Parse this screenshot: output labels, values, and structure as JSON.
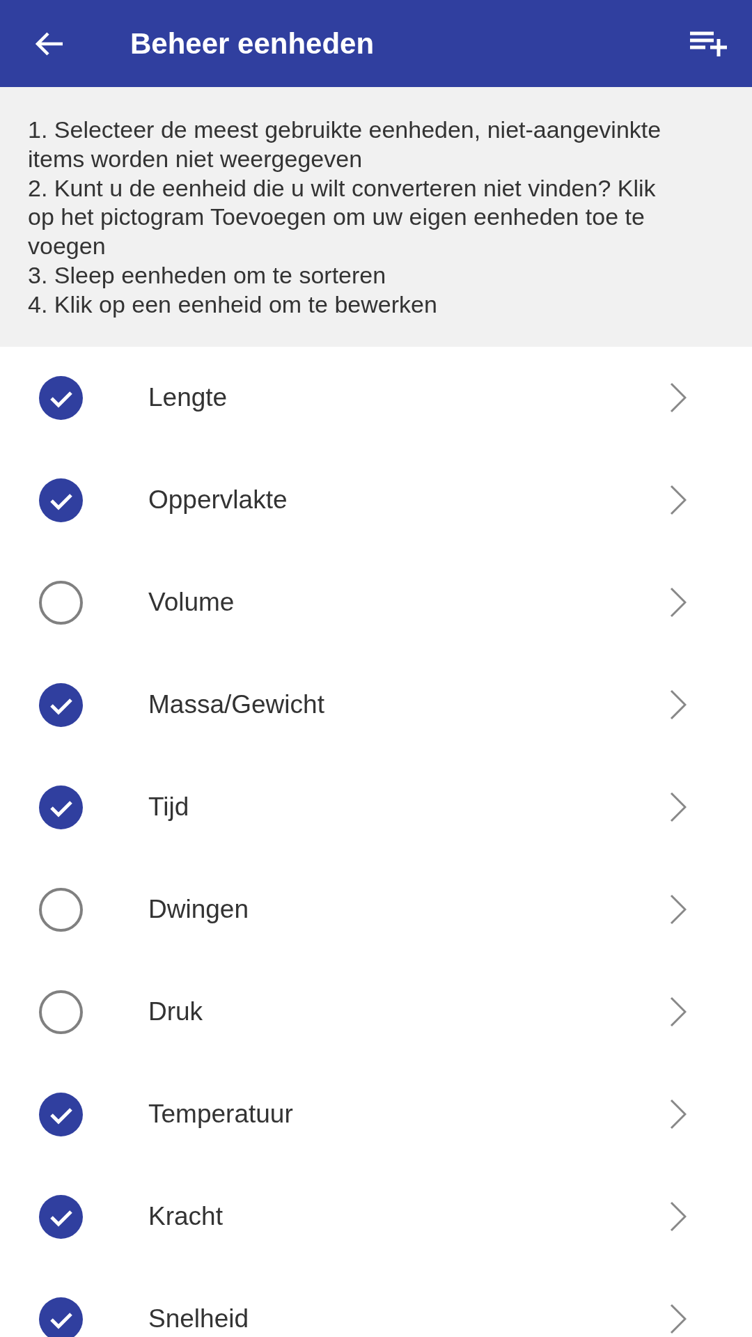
{
  "app_bar": {
    "title": "Beheer eenheden"
  },
  "instructions": [
    "1. Selecteer de meest gebruikte eenheden, niet-aangevinkte items worden niet weergegeven",
    "2. Kunt u de eenheid die u wilt converteren niet vinden? Klik op het pictogram Toevoegen om uw eigen eenheden toe te voegen",
    "3. Sleep eenheden om te sorteren",
    "4. Klik op een eenheid om te bewerken"
  ],
  "units": [
    {
      "name": "Lengte",
      "checked": true
    },
    {
      "name": "Oppervlakte",
      "checked": true
    },
    {
      "name": "Volume",
      "checked": false
    },
    {
      "name": "Massa/Gewicht",
      "checked": true
    },
    {
      "name": "Tijd",
      "checked": true
    },
    {
      "name": "Dwingen",
      "checked": false
    },
    {
      "name": "Druk",
      "checked": false
    },
    {
      "name": "Temperatuur",
      "checked": true
    },
    {
      "name": "Kracht",
      "checked": true
    },
    {
      "name": "Snelheid",
      "checked": true
    }
  ]
}
